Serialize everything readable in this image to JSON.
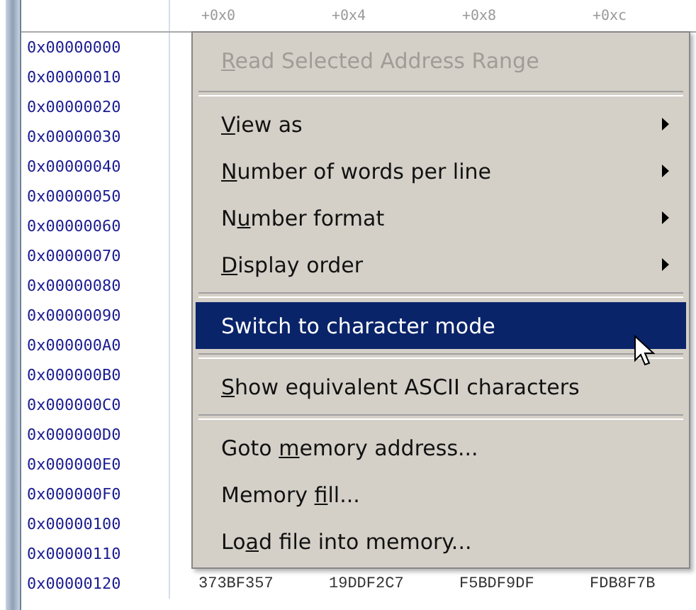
{
  "memory_view": {
    "column_headers": [
      "+0x0",
      "+0x4",
      "+0x8",
      "+0xc"
    ],
    "rows": [
      {
        "address": "0x00000000"
      },
      {
        "address": "0x00000010"
      },
      {
        "address": "0x00000020"
      },
      {
        "address": "0x00000030"
      },
      {
        "address": "0x00000040"
      },
      {
        "address": "0x00000050"
      },
      {
        "address": "0x00000060"
      },
      {
        "address": "0x00000070"
      },
      {
        "address": "0x00000080"
      },
      {
        "address": "0x00000090"
      },
      {
        "address": "0x000000A0"
      },
      {
        "address": "0x000000B0"
      },
      {
        "address": "0x000000C0"
      },
      {
        "address": "0x000000D0"
      },
      {
        "address": "0x000000E0"
      },
      {
        "address": "0x000000F0"
      },
      {
        "address": "0x00000100"
      },
      {
        "address": "0x00000110"
      },
      {
        "address": "0x00000120",
        "values": [
          "373BF357",
          "19DDF2C7",
          "F5BDF9DF",
          "FDB8F7B"
        ]
      }
    ]
  },
  "context_menu": {
    "items": [
      {
        "kind": "item",
        "key": "R",
        "after": "ead Selected Address Range",
        "disabled": true,
        "submenu": false,
        "selected": false
      },
      {
        "kind": "separator"
      },
      {
        "kind": "item",
        "key": "V",
        "after": "iew as",
        "disabled": false,
        "submenu": true,
        "selected": false
      },
      {
        "kind": "item",
        "key": "N",
        "after": "umber of words per line",
        "disabled": false,
        "submenu": true,
        "selected": false
      },
      {
        "kind": "item",
        "before": "N",
        "key": "u",
        "after": "mber format",
        "disabled": false,
        "submenu": true,
        "selected": false
      },
      {
        "kind": "item",
        "key": "D",
        "after": "isplay order",
        "disabled": false,
        "submenu": true,
        "selected": false
      },
      {
        "kind": "separator"
      },
      {
        "kind": "item",
        "before": "Switch to character mode",
        "disabled": false,
        "submenu": false,
        "selected": true
      },
      {
        "kind": "separator"
      },
      {
        "kind": "item",
        "key": "S",
        "after": "how equivalent ASCII characters",
        "disabled": false,
        "submenu": false,
        "selected": false
      },
      {
        "kind": "separator"
      },
      {
        "kind": "item",
        "before": "Goto ",
        "key": "m",
        "after": "emory address...",
        "disabled": false,
        "submenu": false,
        "selected": false
      },
      {
        "kind": "item",
        "before": "Memory ",
        "key": "f",
        "after": "ill...",
        "disabled": false,
        "submenu": false,
        "selected": false
      },
      {
        "kind": "item",
        "before": "Lo",
        "key": "a",
        "after": "d file into memory...",
        "disabled": false,
        "submenu": false,
        "selected": false
      }
    ]
  }
}
